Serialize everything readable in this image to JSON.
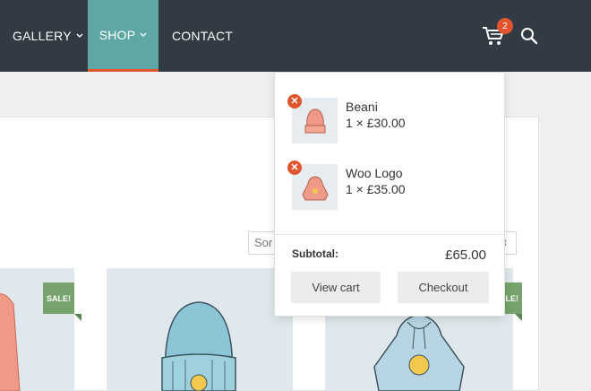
{
  "nav": {
    "items": [
      {
        "label": "GALLERY",
        "has_dropdown": true
      },
      {
        "label": "SHOP",
        "has_dropdown": true,
        "active": true
      },
      {
        "label": "CONTACT",
        "has_dropdown": false
      }
    ],
    "cart_count": "2",
    "cart_icon": "cart-icon",
    "search_icon": "search-icon",
    "colors": {
      "bar": "#323a44",
      "active": "#5ea7a4",
      "accent": "#e0552e"
    }
  },
  "sort": {
    "visible_text": "Sor",
    "arrow": "⇕"
  },
  "products": [
    {
      "badge": "SALE!"
    },
    {
      "badge": ""
    },
    {
      "badge": "SALE!"
    }
  ],
  "minicart": {
    "items": [
      {
        "name": "Beani",
        "qty_price": "1 × £30.00",
        "remove": "✕"
      },
      {
        "name": "Woo Logo",
        "qty_price": "1 × £35.00",
        "remove": "✕"
      }
    ],
    "subtotal_label": "Subtotal:",
    "subtotal_value": "£65.00",
    "view_cart_label": "View cart",
    "checkout_label": "Checkout"
  }
}
